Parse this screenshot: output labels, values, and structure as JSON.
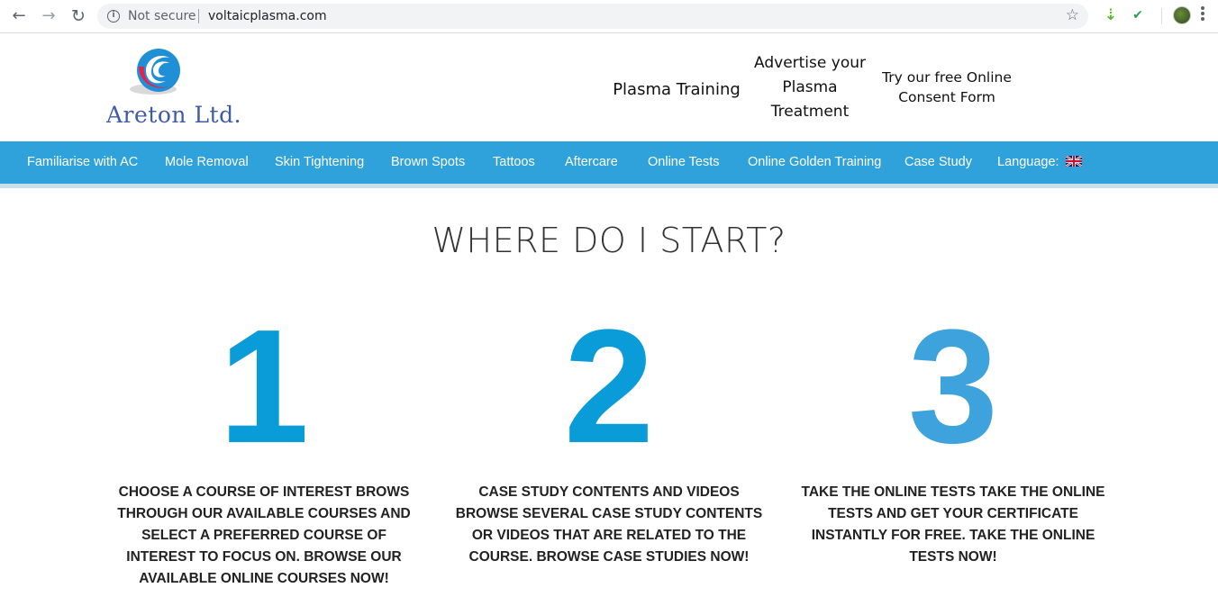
{
  "browser": {
    "security_label": "Not secure",
    "url": "voltaicplasma.com"
  },
  "header": {
    "logo_text": "Areton Ltd.",
    "links": {
      "plasma_training": "Plasma Training",
      "advertise": "Advertise your Plasma Treatment",
      "consent_form": "Try our free Online Consent Form"
    }
  },
  "nav": {
    "items": [
      {
        "label": "Familiarise with AC"
      },
      {
        "label": "Mole Removal"
      },
      {
        "label": "Skin Tightening"
      },
      {
        "label": "Brown Spots"
      },
      {
        "label": "Tattoos"
      },
      {
        "label": "Aftercare"
      },
      {
        "label": "Online Tests"
      },
      {
        "label": "Online Golden Training"
      },
      {
        "label": "Case Study"
      },
      {
        "label": "Language:"
      }
    ]
  },
  "main": {
    "title": "WHERE DO I START?",
    "steps": [
      {
        "number": "1",
        "text": "CHOOSE A COURSE OF INTEREST BROWS THROUGH OUR AVAILABLE COURSES AND SELECT A PREFERRED COURSE OF INTEREST TO FOCUS ON. BROWSE OUR AVAILABLE ONLINE COURSES NOW!"
      },
      {
        "number": "2",
        "text": "CASE STUDY CONTENTS AND VIDEOS BROWSE SEVERAL CASE STUDY CONTENTS OR VIDEOS THAT ARE RELATED TO THE COURSE. BROWSE CASE STUDIES NOW!"
      },
      {
        "number": "3",
        "text": "TAKE THE ONLINE TESTS TAKE THE ONLINE TESTS AND GET YOUR CERTIFICATE INSTANTLY FOR FREE. TAKE THE ONLINE TESTS NOW!"
      }
    ]
  },
  "colors": {
    "nav_bar": "#2fa2dc",
    "step_number": "#0a9cd8",
    "logo_text": "#3f5aa8"
  },
  "icons": [
    "back-arrow-icon",
    "forward-arrow-icon",
    "reload-icon",
    "info-icon",
    "star-icon",
    "download-extension-icon",
    "leaf-extension-icon",
    "profile-avatar",
    "menu-kebab-icon",
    "uk-flag-icon",
    "logo-swirl-icon"
  ]
}
